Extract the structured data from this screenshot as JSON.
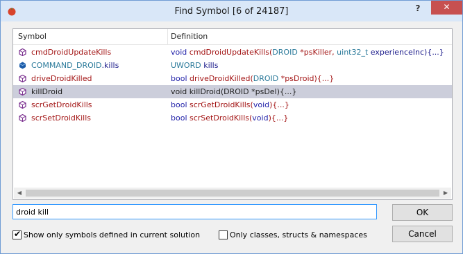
{
  "window": {
    "title": "Find Symbol [6 of 24187]",
    "help_label": "?",
    "close_label": "✕"
  },
  "columns": {
    "symbol": "Symbol",
    "definition": "Definition"
  },
  "rows": [
    {
      "name": "cmdDroidUpdateKills",
      "icon": "function-icon",
      "def_parts": [
        "void ",
        "cmdDroidUpdateKills(",
        "DROID",
        " *psKiller, ",
        "uint32_t",
        " experienceInc){...}"
      ]
    },
    {
      "name_prefix": "COMMAND_DROID",
      "name_suffix": ".kills",
      "icon": "field-icon",
      "def_parts": [
        "UWORD",
        " kills"
      ]
    },
    {
      "name": "driveDroidKilled",
      "icon": "function-icon",
      "def_parts": [
        "bool ",
        "driveDroidKilled(",
        "DROID",
        " *psDroid){...}"
      ]
    },
    {
      "name": "killDroid",
      "icon": "function-icon",
      "selected": true,
      "def_text": "void killDroid(DROID *psDel){...}"
    },
    {
      "name": "scrGetDroidKills",
      "icon": "function-icon",
      "def_parts": [
        "bool ",
        "scrGetDroidKills(",
        "void",
        "){...}"
      ]
    },
    {
      "name": "scrSetDroidKills",
      "icon": "function-icon",
      "def_parts": [
        "bool ",
        "scrSetDroidKills(",
        "void",
        "){...}"
      ]
    }
  ],
  "search": {
    "value": "droid kill"
  },
  "buttons": {
    "ok": "OK",
    "cancel": "Cancel"
  },
  "options": {
    "current_solution_label": "Show only symbols defined in current solution",
    "current_solution_checked": true,
    "classes_only_label": "Only classes, structs & namespaces",
    "classes_only_checked": false
  },
  "colors": {
    "symbol_text": "#a31515",
    "keyword": "#1f1fa8",
    "type": "#2b7a9a",
    "selection": "#cccedb",
    "title_bar": "#d9e7f8",
    "close_button": "#c75050"
  }
}
